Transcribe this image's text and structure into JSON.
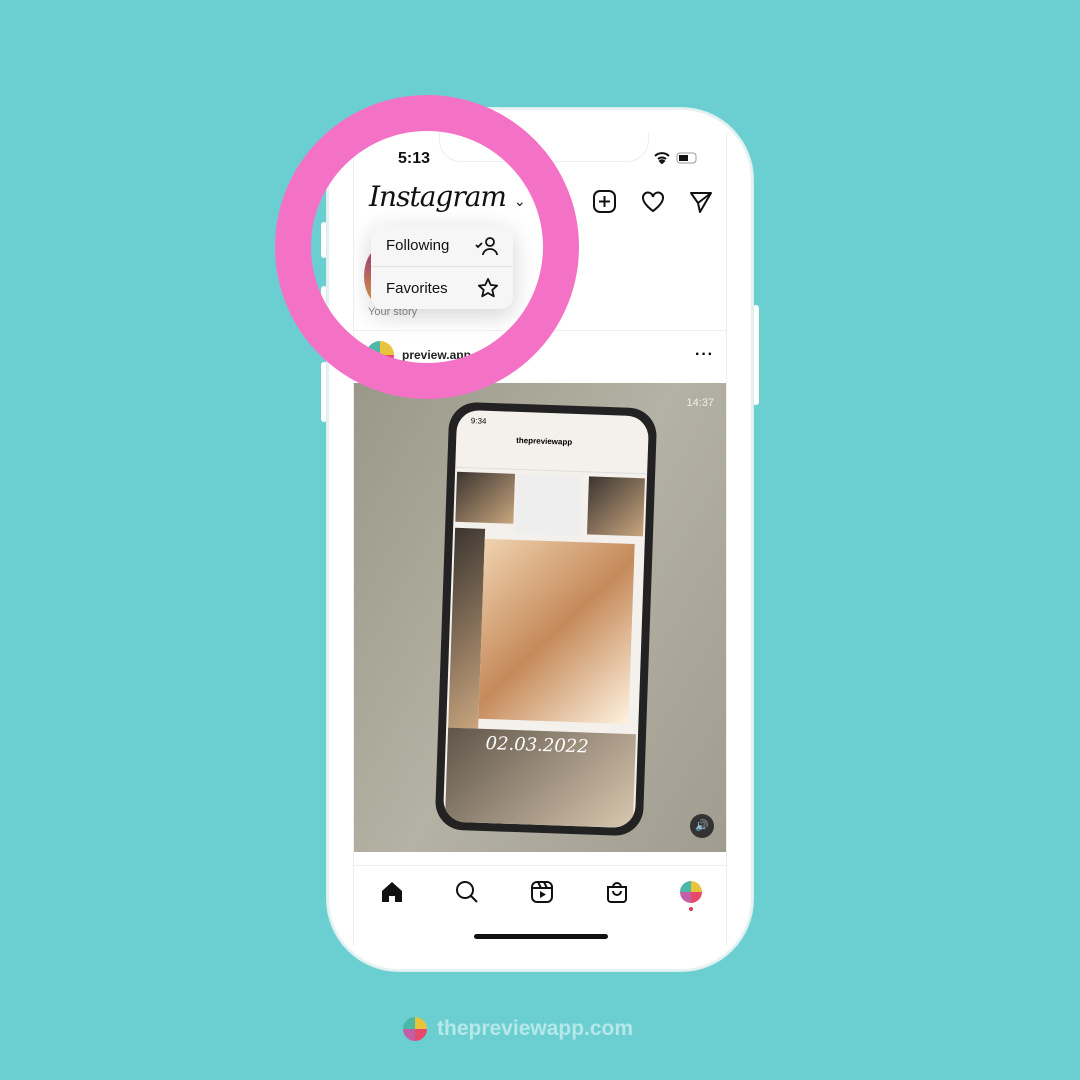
{
  "status_bar": {
    "time": "5:13"
  },
  "header": {
    "logo": "Instagram",
    "icons": [
      "new-post-icon",
      "heart-icon",
      "direct-message-icon"
    ]
  },
  "feed_menu": {
    "items": [
      {
        "label": "Following",
        "icon": "following-person-check-icon"
      },
      {
        "label": "Favorites",
        "icon": "star-icon"
      }
    ]
  },
  "stories": {
    "your_story": "Your story"
  },
  "post": {
    "username": "preview.app",
    "video_time": "14:37",
    "inner_phone": {
      "time": "9:34",
      "username": "thepreviewapp",
      "date_overlay": "02.03.2022"
    }
  },
  "bottom_nav": [
    "home-icon",
    "search-icon",
    "reels-icon",
    "shop-icon",
    "profile-icon"
  ],
  "footer": {
    "brand": "thepreviewapp.com"
  },
  "colors": {
    "background": "#6bcfd1",
    "highlight_ring": "#f472c6"
  }
}
